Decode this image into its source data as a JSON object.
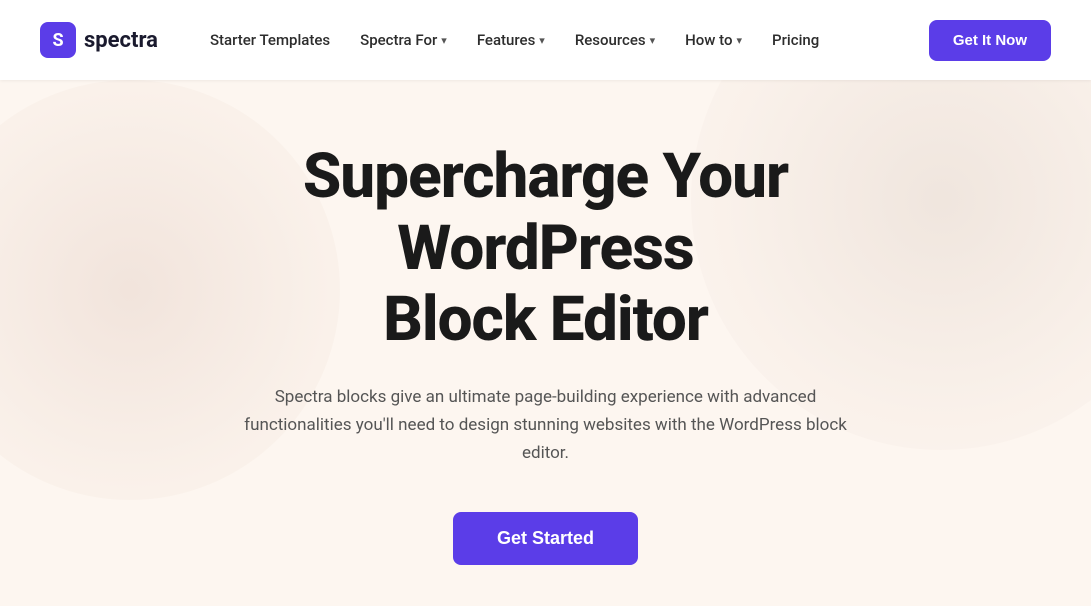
{
  "logo": {
    "icon_letter": "S",
    "text": "spectra"
  },
  "nav": {
    "links": [
      {
        "label": "Starter Templates",
        "has_dropdown": false
      },
      {
        "label": "Spectra For",
        "has_dropdown": true
      },
      {
        "label": "Features",
        "has_dropdown": true
      },
      {
        "label": "Resources",
        "has_dropdown": true
      },
      {
        "label": "How to",
        "has_dropdown": true
      },
      {
        "label": "Pricing",
        "has_dropdown": false
      }
    ],
    "cta_label": "Get It Now"
  },
  "hero": {
    "title_line1": "Supercharge Your WordPress",
    "title_line2": "Block Editor",
    "subtitle": "Spectra blocks give an ultimate page-building experience with advanced functionalities you'll need to design stunning websites with the WordPress block editor.",
    "cta_label": "Get Started"
  },
  "colors": {
    "accent": "#5b3de8",
    "bg": "#fdf6f0"
  }
}
